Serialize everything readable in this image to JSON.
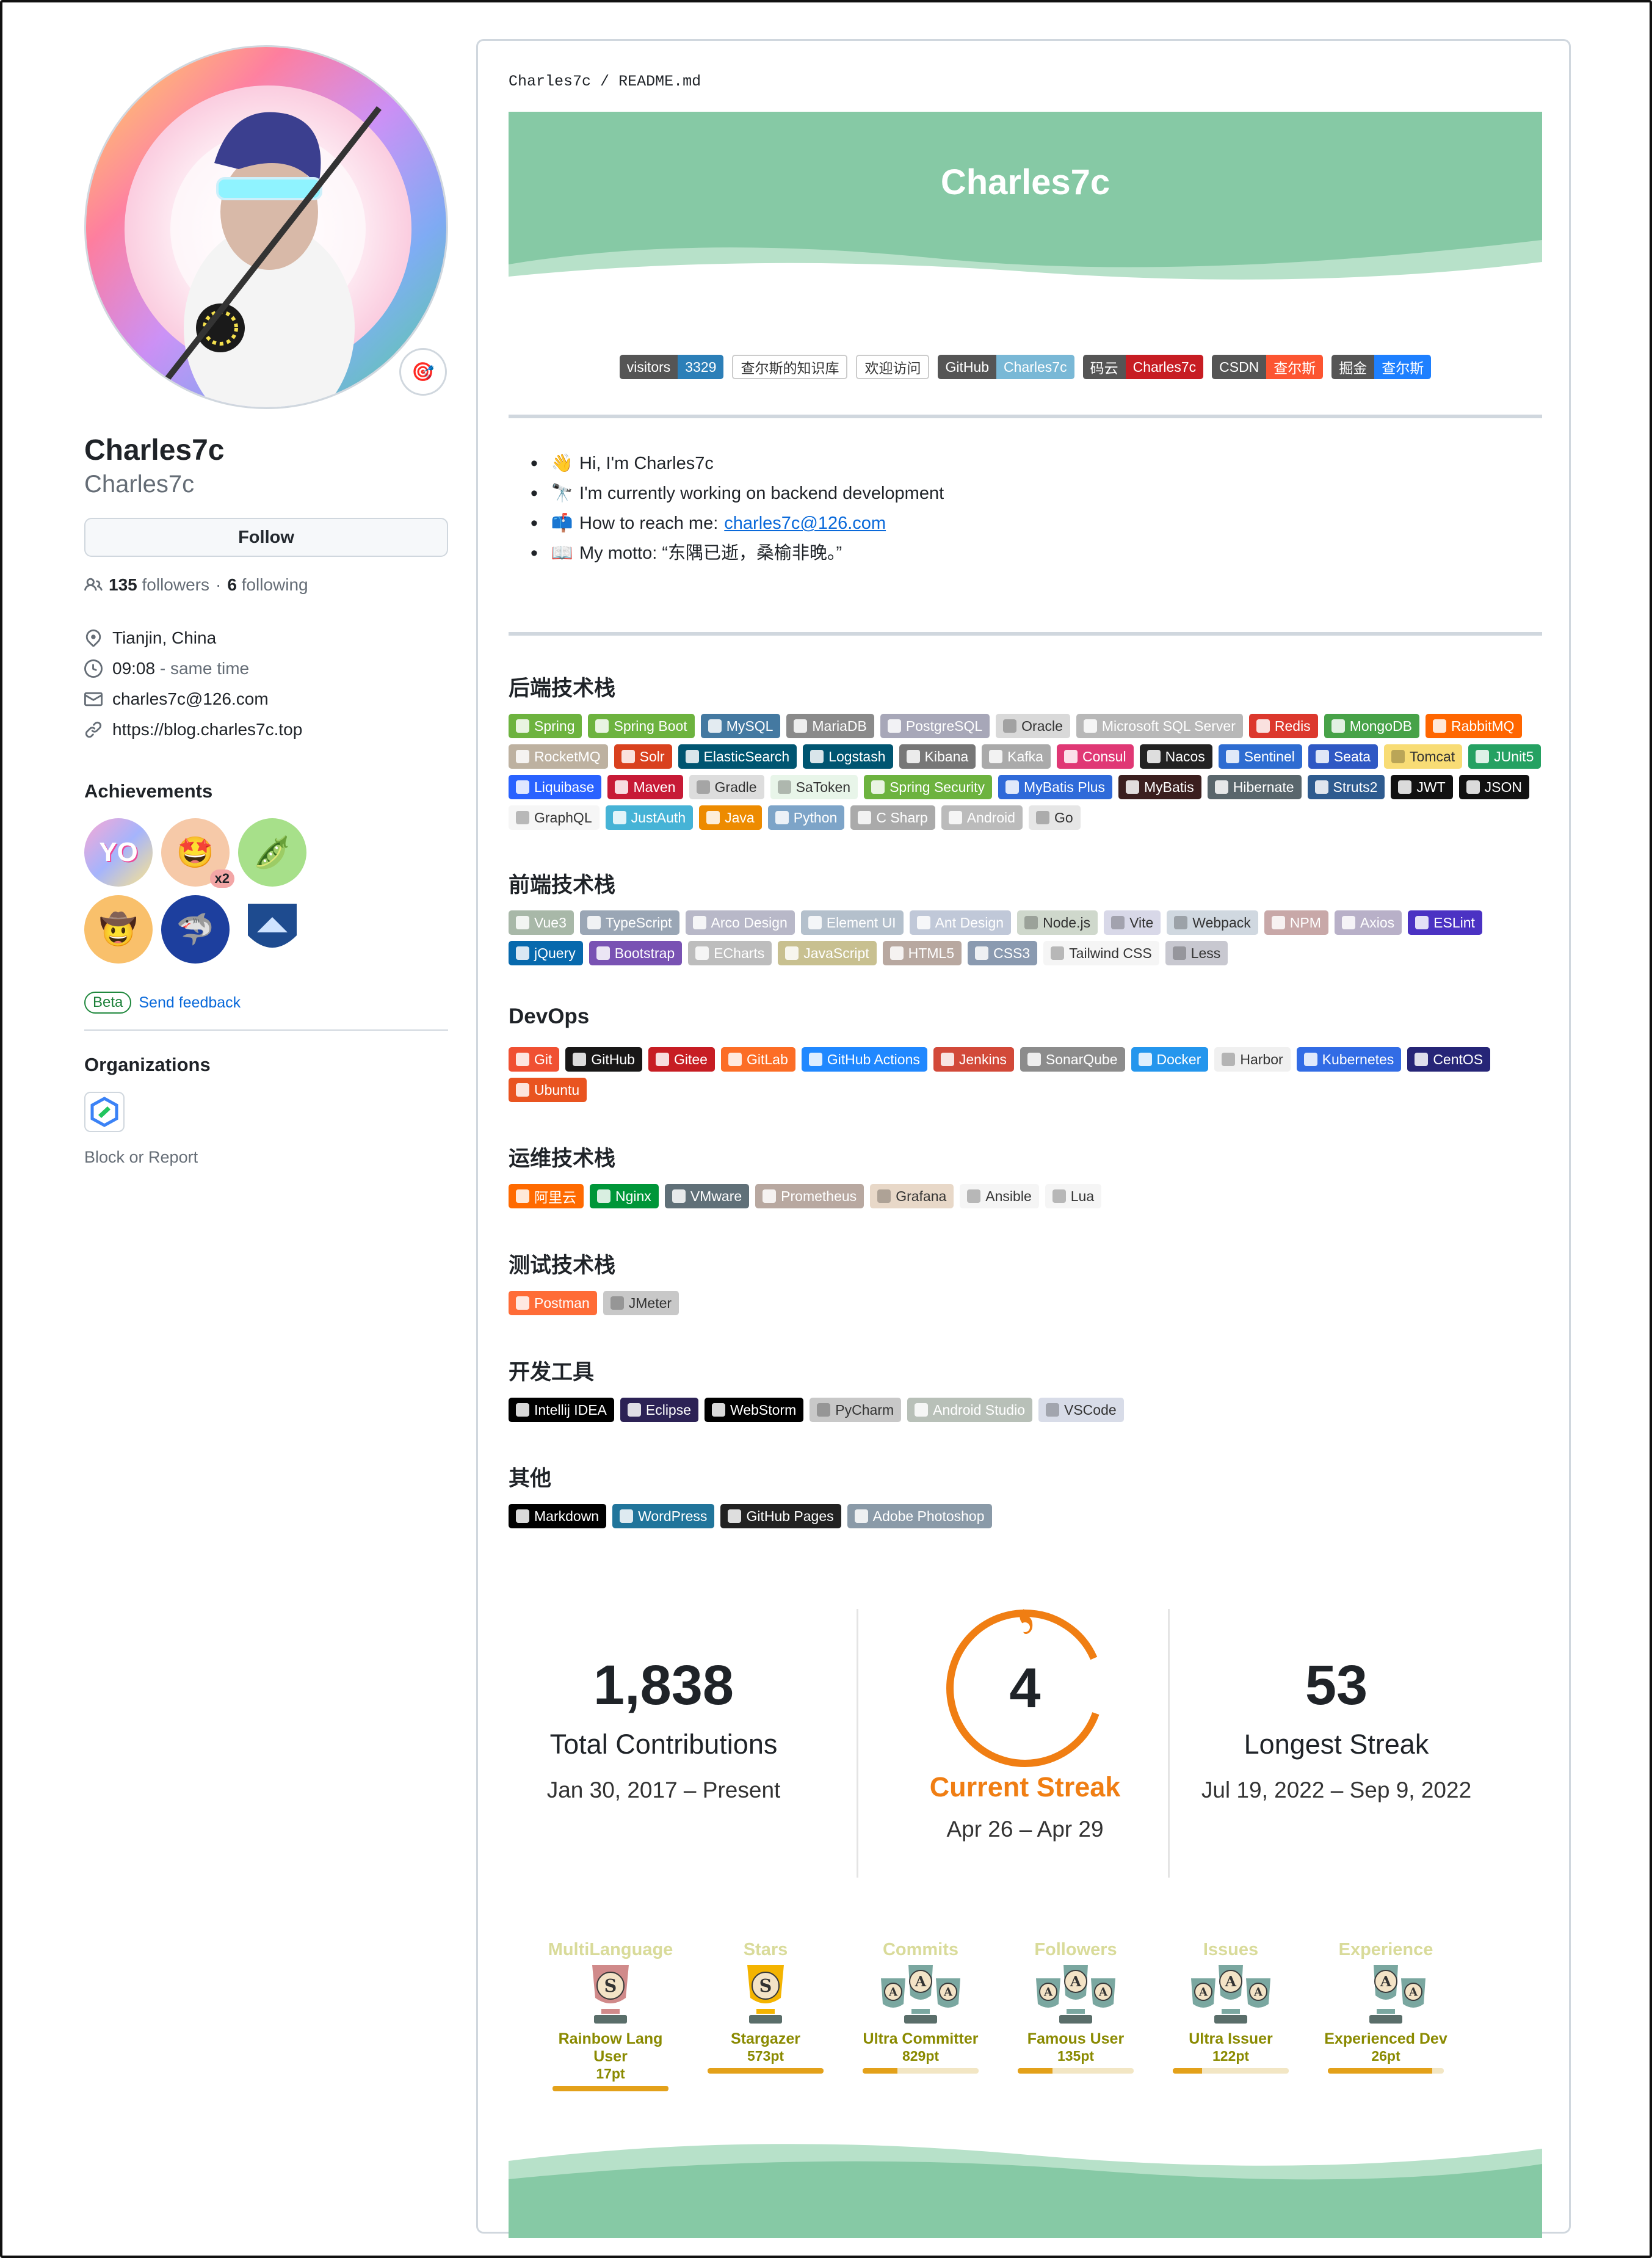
{
  "profile": {
    "name": "Charles7c",
    "login": "Charles7c",
    "follow_label": "Follow",
    "followers": "135",
    "followers_label": "followers",
    "separator": "·",
    "following": "6",
    "following_label": "following",
    "location": "Tianjin, China",
    "time": "09:08",
    "time_suffix": "- same time",
    "email": "charles7c@126.com",
    "website": "https://blog.charles7c.top"
  },
  "achievements": {
    "title": "Achievements",
    "items": [
      "yolo",
      "quickdraw",
      "pair-extraordinaire",
      "starstruck",
      "pull-shark",
      "arctic-code-vault"
    ],
    "multiplier": "x2",
    "beta_label": "Beta",
    "feedback_label": "Send feedback"
  },
  "organizations": {
    "title": "Organizations",
    "block_label": "Block or Report"
  },
  "readme": {
    "path_user": "Charles7c",
    "path_sep": "/",
    "path_file": "README.md",
    "banner_title": "Charles7c",
    "top_badges": [
      {
        "left": "visitors",
        "right": "3329",
        "lc": "#555555",
        "rc": "#2c7fb8"
      },
      {
        "left": "查尔斯的知识库",
        "right": "",
        "lc": "#ffffff",
        "rc": "#ffffff",
        "dark": true
      },
      {
        "left": "欢迎访问",
        "right": "",
        "lc": "#ffffff",
        "rc": "#ffffff",
        "dark": true
      },
      {
        "left": "GitHub",
        "right": "Charles7c",
        "lc": "#555555",
        "rc": "#79b8d6"
      },
      {
        "left": "码云",
        "right": "Charles7c",
        "lc": "#555555",
        "rc": "#c71d23"
      },
      {
        "left": "CSDN",
        "right": "查尔斯",
        "lc": "#555555",
        "rc": "#fc5531"
      },
      {
        "left": "掘金",
        "right": "查尔斯",
        "lc": "#555555",
        "rc": "#1e80ff"
      }
    ],
    "intro": [
      {
        "emoji": "👋",
        "text": "Hi, I'm Charles7c"
      },
      {
        "emoji": "🔭",
        "text": "I'm currently working on backend development"
      },
      {
        "emoji": "📫",
        "text": "How to reach me:",
        "link": "charles7c@126.com"
      },
      {
        "emoji": "📖",
        "text": "My motto: “东隅已逝，桑榆非晚。”"
      }
    ]
  },
  "stacks": [
    {
      "title": "后端技术栈",
      "badges": [
        [
          "Spring",
          "#6db33f"
        ],
        [
          "Spring Boot",
          "#6db33f"
        ],
        [
          "MySQL",
          "#4479a1"
        ],
        [
          "MariaDB",
          "#8a8a8a"
        ],
        [
          "PostgreSQL",
          "#a7a7b8"
        ],
        [
          "Oracle",
          "#d9d9d9"
        ],
        [
          "Microsoft SQL Server",
          "#b8b8b8"
        ],
        [
          "Redis",
          "#dc382d"
        ],
        [
          "MongoDB",
          "#47a248"
        ],
        [
          "RabbitMQ",
          "#ff6600"
        ],
        [
          "RocketMQ",
          "#bdb1a0"
        ],
        [
          "Solr",
          "#d9411e"
        ],
        [
          "ElasticSearch",
          "#005571"
        ],
        [
          "Logstash",
          "#005571"
        ],
        [
          "Kibana",
          "#777777"
        ],
        [
          "Kafka",
          "#aaaaaa"
        ],
        [
          "Consul",
          "#e03875"
        ],
        [
          "Nacos",
          "#222222"
        ],
        [
          "Sentinel",
          "#2e6cd1"
        ],
        [
          "Seata",
          "#2f58c4"
        ],
        [
          "Tomcat",
          "#f8dc75"
        ],
        [
          "JUnit5",
          "#25a162"
        ],
        [
          "Liquibase",
          "#2962ff"
        ],
        [
          "Maven",
          "#c71a36"
        ],
        [
          "Gradle",
          "#dddddd"
        ],
        [
          "SaToken",
          "#e8f5e9"
        ],
        [
          "Spring Security",
          "#6db33f"
        ],
        [
          "MyBatis Plus",
          "#2f6ad9"
        ],
        [
          "MyBatis",
          "#3b1f1f"
        ],
        [
          "Hibernate",
          "#59666c"
        ],
        [
          "Struts2",
          "#2e5b8f"
        ],
        [
          "JWT",
          "#111111"
        ],
        [
          "JSON",
          "#111111"
        ],
        [
          "GraphQL",
          "#f6f6f6"
        ],
        [
          "JustAuth",
          "#46b3d6"
        ],
        [
          "Java",
          "#ed8b00"
        ],
        [
          "Python",
          "#7da4c8"
        ],
        [
          "C Sharp",
          "#aaaaaa"
        ],
        [
          "Android",
          "#bbbbbb"
        ],
        [
          "Go",
          "#e6e6e6"
        ]
      ]
    },
    {
      "title": "前端技术栈",
      "badges": [
        [
          "Vue3",
          "#a8b8a8"
        ],
        [
          "TypeScript",
          "#9aa6b5"
        ],
        [
          "Arco Design",
          "#b8b8c8"
        ],
        [
          "Element UI",
          "#b4c0cc"
        ],
        [
          "Ant Design",
          "#c0c8d8"
        ],
        [
          "Node.js",
          "#cfd8cc"
        ],
        [
          "Vite",
          "#d8d8e8"
        ],
        [
          "Webpack",
          "#d0d8e0"
        ],
        [
          "NPM",
          "#c8a8a8"
        ],
        [
          "Axios",
          "#b8b0c8"
        ],
        [
          "ESLint",
          "#4b32c3"
        ],
        [
          "jQuery",
          "#0769ad"
        ],
        [
          "Bootstrap",
          "#7952b3"
        ],
        [
          "ECharts",
          "#bdbdbd"
        ],
        [
          "JavaScript",
          "#c8c090"
        ],
        [
          "HTML5",
          "#b8a8a0"
        ],
        [
          "CSS3",
          "#8a9ab0"
        ],
        [
          "Tailwind CSS",
          "#f5f5f5"
        ],
        [
          "Less",
          "#c8c8d0"
        ]
      ]
    },
    {
      "title": "DevOps",
      "badges": [
        [
          "Git",
          "#f05032"
        ],
        [
          "GitHub",
          "#181717"
        ],
        [
          "Gitee",
          "#c71d23"
        ],
        [
          "GitLab",
          "#fc6d26"
        ],
        [
          "GitHub Actions",
          "#2088ff"
        ],
        [
          "Jenkins",
          "#d24939"
        ],
        [
          "SonarQube",
          "#8c8c8c"
        ],
        [
          "Docker",
          "#2496ed"
        ],
        [
          "Harbor",
          "#f0f0f0"
        ],
        [
          "Kubernetes",
          "#326ce5"
        ],
        [
          "CentOS",
          "#262577"
        ],
        [
          "Ubuntu",
          "#e95420"
        ]
      ]
    },
    {
      "title": "运维技术栈",
      "badges": [
        [
          "阿里云",
          "#ff6a00"
        ],
        [
          "Nginx",
          "#009639"
        ],
        [
          "VMware",
          "#607078"
        ],
        [
          "Prometheus",
          "#b8a8a0"
        ],
        [
          "Grafana",
          "#e8d8c8"
        ],
        [
          "Ansible",
          "#f5f5f5"
        ],
        [
          "Lua",
          "#f5f5f5"
        ]
      ]
    },
    {
      "title": "测试技术栈",
      "badges": [
        [
          "Postman",
          "#ff6c37"
        ],
        [
          "JMeter",
          "#c8c8c8"
        ]
      ]
    },
    {
      "title": "开发工具",
      "badges": [
        [
          "Intellij IDEA",
          "#000000"
        ],
        [
          "Eclipse",
          "#2c2255"
        ],
        [
          "WebStorm",
          "#000000"
        ],
        [
          "PyCharm",
          "#c8c8c8"
        ],
        [
          "Android Studio",
          "#b8c0b8"
        ],
        [
          "VSCode",
          "#d8dce8"
        ]
      ]
    },
    {
      "title": "其他",
      "badges": [
        [
          "Markdown",
          "#000000"
        ],
        [
          "WordPress",
          "#21759b"
        ],
        [
          "GitHub Pages",
          "#222222"
        ],
        [
          "Adobe Photoshop",
          "#8a9aa8"
        ]
      ]
    }
  ],
  "streak": {
    "total": "1,838",
    "total_label": "Total Contributions",
    "total_range": "Jan 30, 2017 – Present",
    "current": "4",
    "current_label": "Current Streak",
    "current_range": "Apr 26 – Apr 29",
    "longest": "53",
    "longest_label": "Longest Streak",
    "longest_range": "Jul 19, 2022 – Sep 9, 2022",
    "accent": "#f07e13"
  },
  "trophies": [
    {
      "category": "MultiLanguage",
      "rank": "S",
      "title": "Rainbow Lang User",
      "points": "17pt",
      "progress": 1.0
    },
    {
      "category": "Stars",
      "rank": "S",
      "title": "Stargazer",
      "points": "573pt",
      "progress": 1.0
    },
    {
      "category": "Commits",
      "rank": "AAA",
      "title": "Ultra Committer",
      "points": "829pt",
      "progress": 0.3
    },
    {
      "category": "Followers",
      "rank": "AAA",
      "title": "Famous User",
      "points": "135pt",
      "progress": 0.3
    },
    {
      "category": "Issues",
      "rank": "AAA",
      "title": "Ultra Issuer",
      "points": "122pt",
      "progress": 0.25
    },
    {
      "category": "Experience",
      "rank": "AA",
      "title": "Experienced Dev",
      "points": "26pt",
      "progress": 0.9
    }
  ]
}
